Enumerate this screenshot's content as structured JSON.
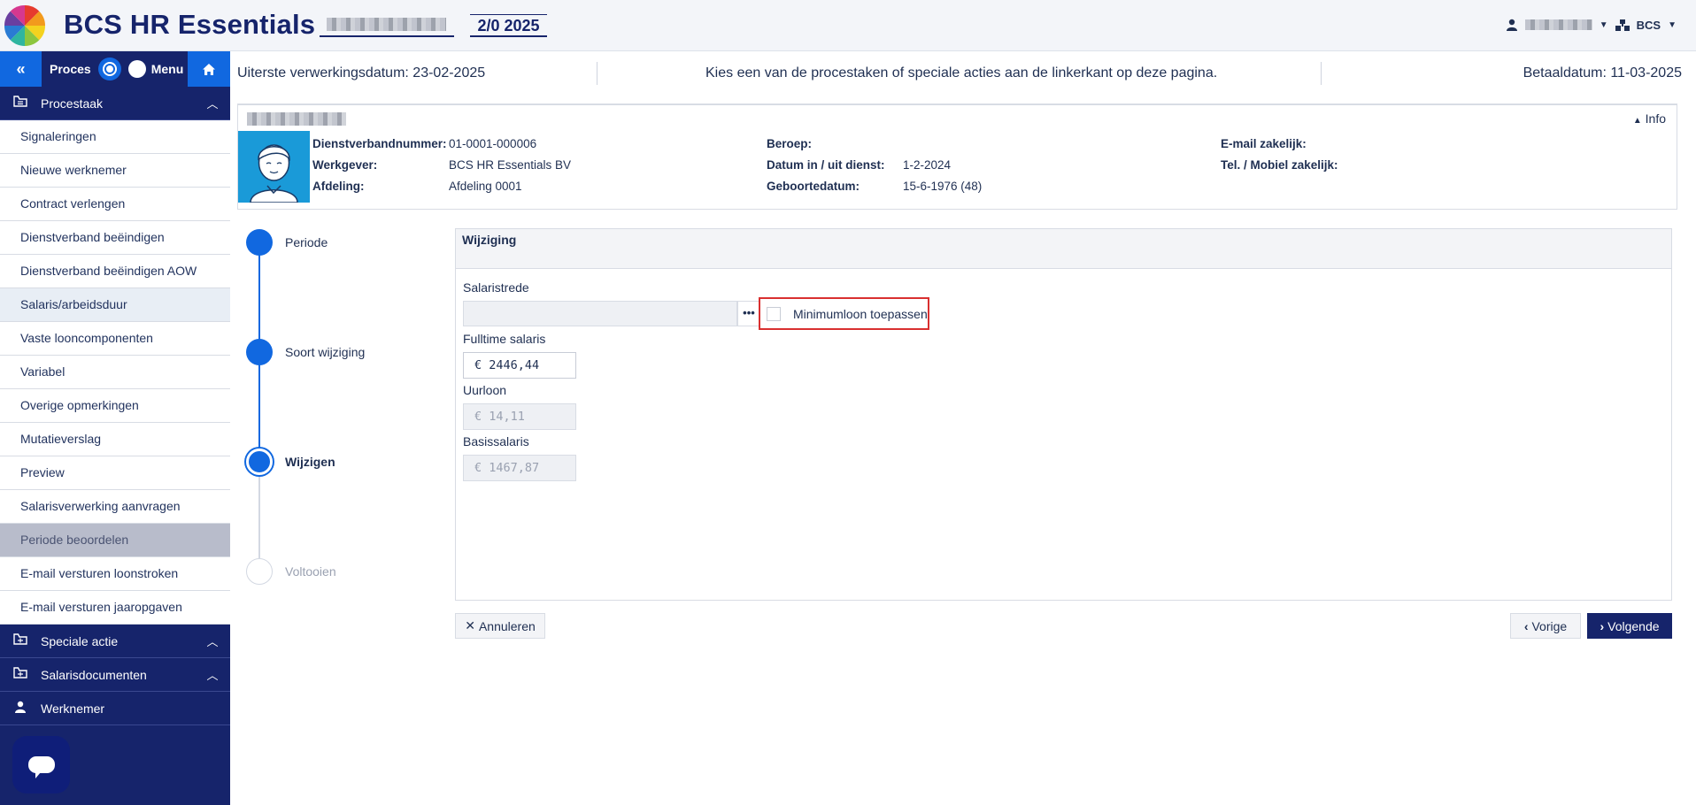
{
  "header": {
    "app_title": "BCS HR Essentials",
    "period": "2/0 2025",
    "org_label": "BCS"
  },
  "sidebar": {
    "mode_proces": "Proces",
    "mode_menu": "Menu",
    "sections": {
      "procestaak": "Procestaak",
      "speciale_actie": "Speciale actie",
      "salarisdocumenten": "Salarisdocumenten",
      "werknemer": "Werknemer"
    },
    "items": [
      "Signaleringen",
      "Nieuwe werknemer",
      "Contract verlengen",
      "Dienstverband beëindigen",
      "Dienstverband beëindigen AOW",
      "Salaris/arbeidsduur",
      "Vaste looncomponenten",
      "Variabel",
      "Overige opmerkingen",
      "Mutatieverslag",
      "Preview",
      "Salarisverwerking aanvragen",
      "Periode beoordelen",
      "E-mail versturen loonstroken",
      "E-mail versturen jaaropgaven"
    ]
  },
  "infobar": {
    "deadline": "Uiterste verwerkingsdatum: 23-02-2025",
    "instruction": "Kies een van de procestaken of speciale acties aan de linkerkant op deze pagina.",
    "paydate": "Betaaldatum: 11-03-2025"
  },
  "employee": {
    "info_link": "Info",
    "labels": {
      "dienstverband": "Dienstverbandnummer:",
      "werkgever": "Werkgever:",
      "afdeling": "Afdeling:",
      "beroep": "Beroep:",
      "datum": "Datum in / uit dienst:",
      "geboorte": "Geboortedatum:",
      "email": "E-mail zakelijk:",
      "tel": "Tel. / Mobiel zakelijk:"
    },
    "values": {
      "dienstverband": "01-0001-000006",
      "werkgever": "BCS HR Essentials BV",
      "afdeling": "Afdeling 0001",
      "beroep": "",
      "datum": "1-2-2024",
      "geboorte": "15-6-1976 (48)",
      "email": "",
      "tel": ""
    }
  },
  "stepper": {
    "steps": [
      "Periode",
      "Soort wijziging",
      "Wijzigen",
      "Voltooien"
    ]
  },
  "form": {
    "title": "Wijziging",
    "salaristrede_label": "Salaristrede",
    "salaristrede_value": "",
    "dots": "•••",
    "minimumloon_label": "Minimumloon toepassen",
    "fulltime_label": "Fulltime salaris",
    "fulltime_value": "€ 2446,44",
    "uurloon_label": "Uurloon",
    "uurloon_value": "€ 14,11",
    "basis_label": "Basissalaris",
    "basis_value": "€ 1467,87"
  },
  "buttons": {
    "cancel": "Annuleren",
    "prev": "Vorige",
    "next": "Volgende"
  },
  "colors": {
    "navy": "#16246b",
    "accent_blue": "#1168e0",
    "highlight_red": "#d93030"
  }
}
